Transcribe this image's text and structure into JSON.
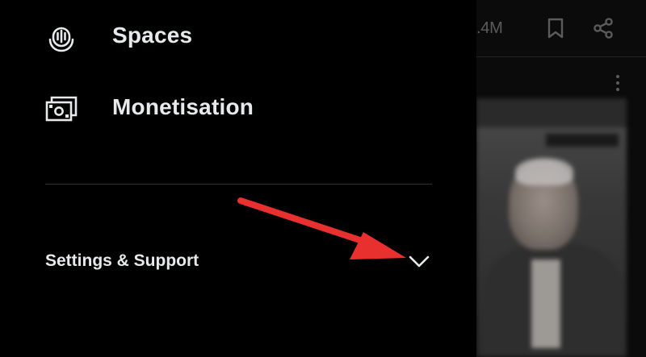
{
  "drawer": {
    "items": [
      {
        "label": "Spaces",
        "icon": "spaces-microphone-icon"
      },
      {
        "label": "Monetisation",
        "icon": "money-icon"
      }
    ],
    "settings": {
      "label": "Settings & Support",
      "icon": "chevron-down-icon",
      "expanded": false
    }
  },
  "feed": {
    "views_count": ".4M",
    "icons": [
      "bookmark-icon",
      "share-icon",
      "more-vertical-icon"
    ]
  },
  "annotation": {
    "type": "arrow",
    "color": "#e8302e"
  },
  "colors": {
    "background": "#000000",
    "text": "#e7e9ea",
    "divider": "#2f3336",
    "dim_icon": "#5b5b5b"
  }
}
